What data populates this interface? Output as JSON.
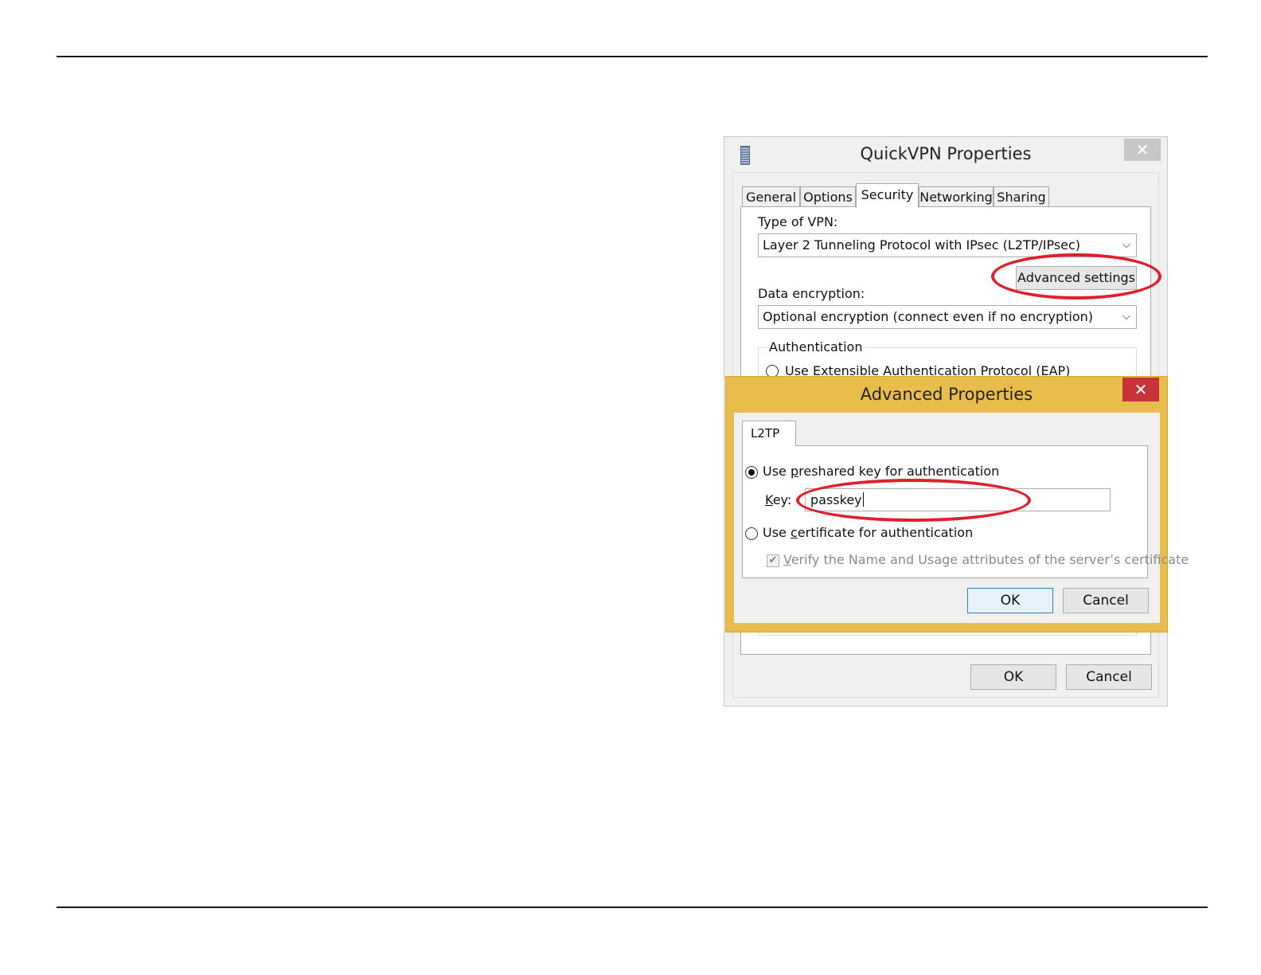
{
  "quickvpn": {
    "title": "QuickVPN Properties",
    "close_glyph": "✕",
    "tabs": [
      {
        "label": "General"
      },
      {
        "label": "Options"
      },
      {
        "label": "Security"
      },
      {
        "label": "Networking"
      },
      {
        "label": "Sharing"
      }
    ],
    "active_tab": "Security",
    "vpn_type_label": "Type of VPN:",
    "vpn_type_value": "Layer 2 Tunneling Protocol with IPsec (L2TP/IPsec)",
    "advanced_settings_label": "Advanced settings",
    "data_encryption_label": "Data encryption:",
    "data_encryption_value": "Optional encryption (connect even if no encryption)",
    "authentication_legend": "Authentication",
    "eap_option_label": "Use Extensible Authentication Protocol (EAP)",
    "ok_label": "OK",
    "cancel_label": "Cancel"
  },
  "advanced": {
    "title": "Advanced Properties",
    "close_glyph": "✕",
    "tab_label": "L2TP",
    "preshared_option": {
      "prefix": "Use ",
      "access_key": "p",
      "rest": "reshared key for authentication",
      "selected": true
    },
    "key_label": {
      "access_key": "K",
      "rest": "ey:"
    },
    "key_value": "passkey",
    "certificate_option": {
      "prefix": "Use ",
      "access_key": "c",
      "rest": "ertificate for authentication",
      "selected": false
    },
    "verify_option": {
      "access_key": "V",
      "rest": "erify the Name and Usage attributes of the server’s certificate",
      "checked": true,
      "disabled": true
    },
    "ok_label": "OK",
    "cancel_label": "Cancel"
  },
  "colors": {
    "highlight_ellipse": "#e0202a",
    "advanced_frame": "#e8bd4c",
    "advanced_close": "#c8333a"
  }
}
